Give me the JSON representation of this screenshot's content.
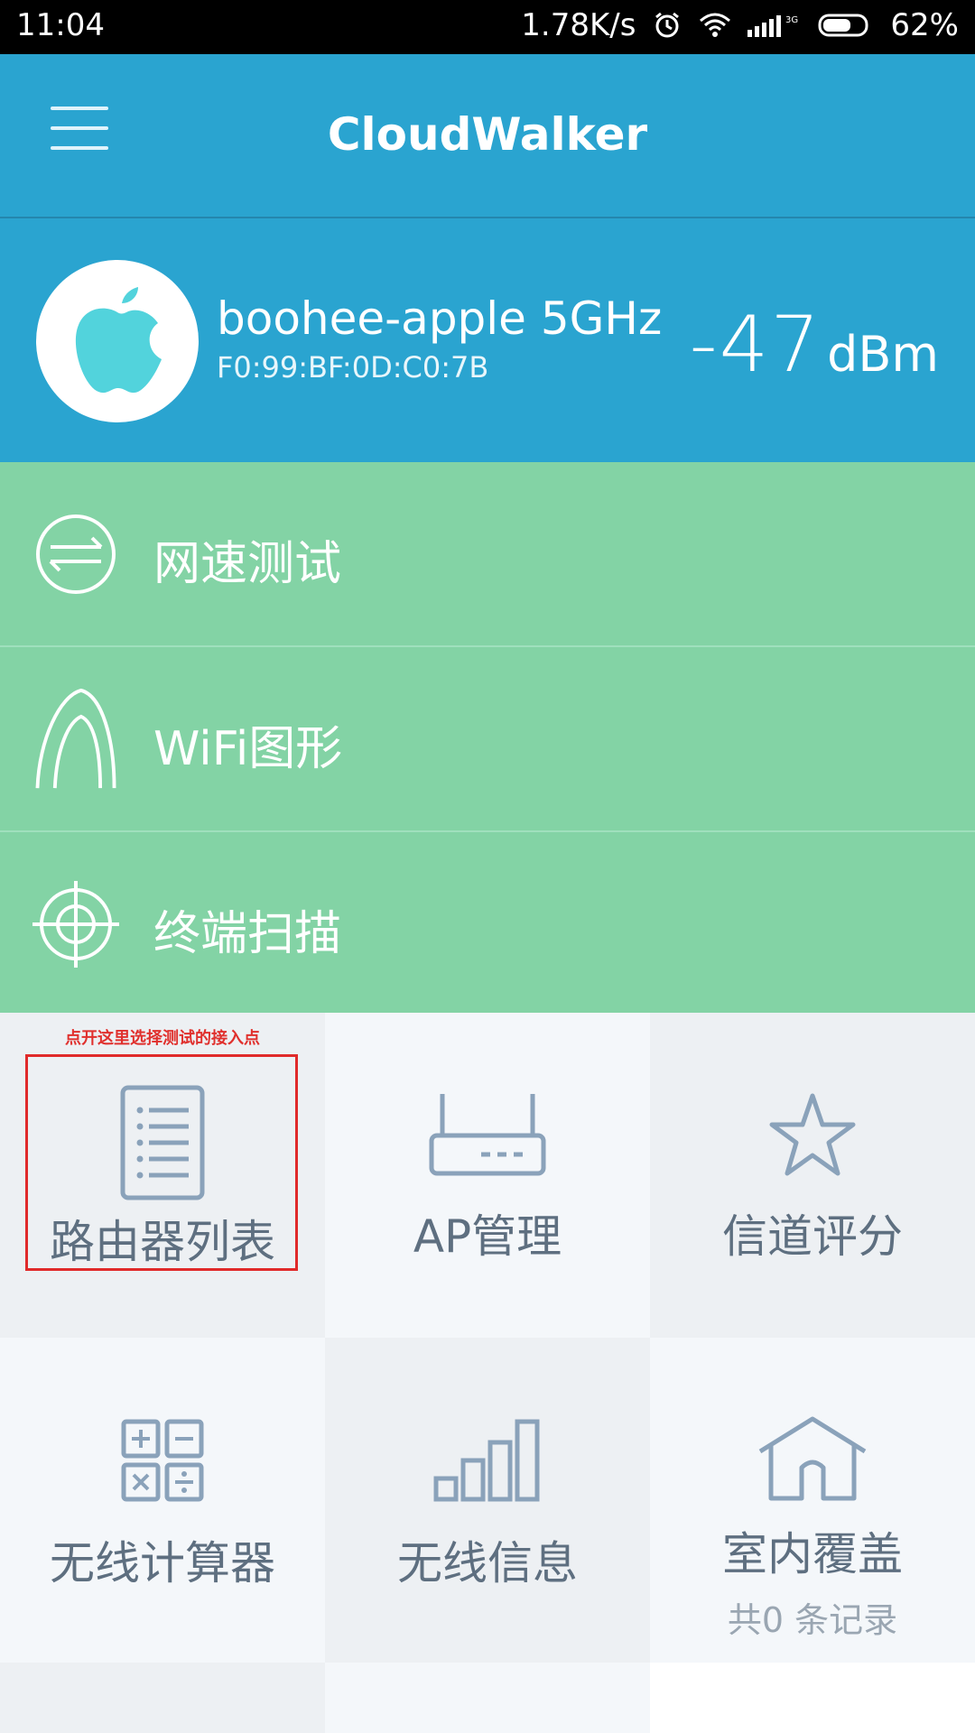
{
  "status_bar": {
    "time": "11:04",
    "net_speed": "1.78K/s",
    "network_tag": "3G 1X",
    "battery": "62%"
  },
  "app_bar": {
    "title": "CloudWalker",
    "menu_icon": "hamburger-icon"
  },
  "wifi": {
    "ssid": "boohee-apple 5GHz",
    "bssid": "F0:99:BF:0D:C0:7B",
    "signal_value": "-47",
    "signal_unit": "dBm",
    "icon": "apple-icon"
  },
  "menu": [
    {
      "label": "网速测试",
      "icon": "speed-test-icon"
    },
    {
      "label": "WiFi图形",
      "icon": "wifi-graph-icon"
    },
    {
      "label": "终端扫描",
      "icon": "target-scan-icon"
    }
  ],
  "tiles": {
    "hint": "点开这里选择测试的接入点",
    "router_list": "路由器列表",
    "ap_manage": "AP管理",
    "channel_score": "信道评分",
    "wireless_calc": "无线计算器",
    "wireless_info": "无线信息",
    "indoor_coverage": "室内覆盖",
    "indoor_records": "共0 条记录"
  },
  "colors": {
    "primary": "#2aa4d0",
    "menu_green": "#83d3a5",
    "tile_light": "#f4f7fa",
    "tile_gray": "#edf0f3",
    "hint_red": "#e02a2a"
  }
}
